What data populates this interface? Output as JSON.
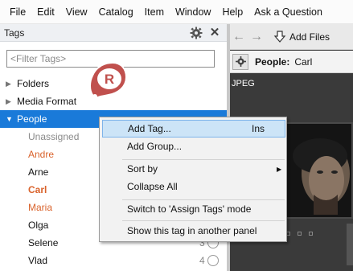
{
  "menubar": [
    "File",
    "Edit",
    "View",
    "Catalog",
    "Item",
    "Window",
    "Help",
    "Ask a Question"
  ],
  "tags_panel": {
    "title": "Tags",
    "filter_placeholder": "<Filter Tags>",
    "groups": [
      {
        "label": "Folders",
        "expanded": false
      },
      {
        "label": "Media Format",
        "expanded": false
      },
      {
        "label": "People",
        "expanded": true,
        "selected": true
      }
    ],
    "people": [
      {
        "name": "Unassigned",
        "style": "gray",
        "count": ""
      },
      {
        "name": "Andre",
        "style": "orange",
        "count": ""
      },
      {
        "name": "Arne",
        "style": "black",
        "count": ""
      },
      {
        "name": "Carl",
        "style": "bold",
        "count": ""
      },
      {
        "name": "Maria",
        "style": "orange",
        "count": ""
      },
      {
        "name": "Olga",
        "style": "black",
        "count": ""
      },
      {
        "name": "Selene",
        "style": "black",
        "count": "3"
      },
      {
        "name": "Vlad",
        "style": "black",
        "count": "4"
      }
    ]
  },
  "context_menu": {
    "items": [
      {
        "label": "Add Tag...",
        "shortcut": "Ins"
      },
      {
        "label": "Add Group..."
      },
      {
        "label": "Sort by"
      },
      {
        "label": "Collapse All"
      },
      {
        "label": "Switch to 'Assign Tags' mode"
      },
      {
        "label": "Show this tag in another panel"
      }
    ]
  },
  "right_panel": {
    "add_files_label": "Add Files",
    "breadcrumb_people": "People:",
    "breadcrumb_value": "Carl",
    "media_label": "JPEG"
  },
  "badge_letter": "R",
  "colors": {
    "accent": "#1a7ad9",
    "highlight": "#cce4f7",
    "orange": "#d9622b",
    "badge": "#c0504d"
  }
}
